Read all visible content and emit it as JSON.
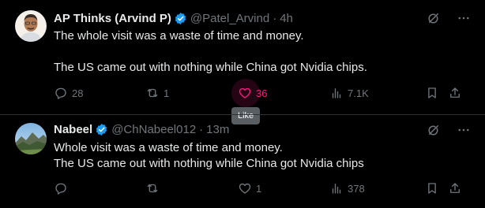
{
  "tweets": [
    {
      "name": "AP Thinks (Arvind P)",
      "handle": "@Patel_Arvind",
      "time": "4h",
      "text": "The whole visit was a waste of time and money.\n\nThe US came out with nothing while China got Nvidia chips.",
      "replies": "28",
      "retweets": "1",
      "likes": "36",
      "views": "7.1K",
      "liked": true
    },
    {
      "name": "Nabeel",
      "handle": "@ChNabeel012",
      "time": "13m",
      "text": "Whole visit was a waste of time and money.\nThe US came out with nothing while China got Nvidia chips",
      "replies": "",
      "retweets": "",
      "likes": "1",
      "views": "378",
      "liked": false
    }
  ],
  "separator": "·",
  "tooltip": "Like",
  "colors": {
    "background": "#000000",
    "text": "#e7e9ea",
    "muted": "#71767b",
    "verified": "#1d9bf0",
    "like_active": "#f91880",
    "divider": "#2f3336"
  },
  "icons": [
    "verified-badge-icon",
    "grok-icon",
    "more-icon",
    "reply-icon",
    "retweet-icon",
    "like-icon",
    "views-icon",
    "bookmark-icon",
    "share-icon"
  ]
}
